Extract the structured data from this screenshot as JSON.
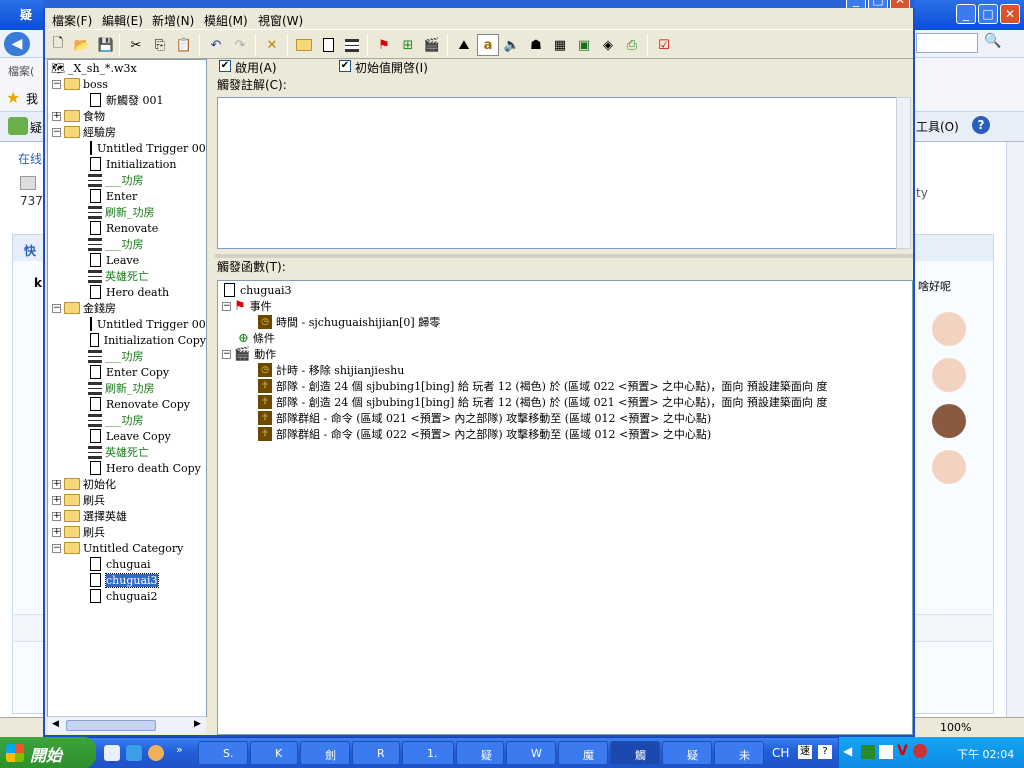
{
  "background_window": {
    "title": "疑",
    "menu": "檔案(",
    "fav_label": "我",
    "tab_label": "疑",
    "left_text1": "在线",
    "left_text2": "737",
    "left_text3": "快",
    "left_text4": "k",
    "right_text_ty": "ty",
    "tab_hint": "啥好呢",
    "tools_menu": "工具(O)",
    "zoom": "100%"
  },
  "menubar": {
    "items": [
      "檔案(F)",
      "編輯(E)",
      "新增(N)",
      "模組(M)",
      "視窗(W)"
    ]
  },
  "toolbar": {
    "icons": [
      "new-icon",
      "open-icon",
      "save-icon",
      "cut-icon",
      "copy-icon",
      "paste-icon",
      "undo-icon",
      "redo-icon",
      "delete-icon",
      "new-category-icon",
      "new-trigger-icon",
      "new-comment-icon",
      "event-flag-icon",
      "new-variable-icon",
      "test-map-icon",
      "terrain-editor-icon",
      "unit-editor-icon",
      "sound-editor-icon",
      "object-editor-icon",
      "import-manager-icon",
      "ai-editor-icon",
      "campaign-editor-icon",
      "object-manager-icon",
      "test-map-run-icon"
    ]
  },
  "tree": {
    "root": "_X_sh_*.w3x",
    "nodes": [
      {
        "level": 1,
        "type": "folder",
        "label": "boss",
        "expand": "-"
      },
      {
        "level": 2,
        "type": "doc",
        "label": "新觸發 001"
      },
      {
        "level": 1,
        "type": "folder",
        "label": "食物",
        "expand": "+"
      },
      {
        "level": 1,
        "type": "folder",
        "label": "經驗房",
        "expand": "-"
      },
      {
        "level": 2,
        "type": "doc",
        "label": "Untitled Trigger 001"
      },
      {
        "level": 2,
        "type": "doc",
        "label": "Initialization"
      },
      {
        "level": 2,
        "type": "var",
        "label": "___功房",
        "green": true
      },
      {
        "level": 2,
        "type": "doc",
        "label": "Enter"
      },
      {
        "level": 2,
        "type": "var",
        "label": "刷新_功房",
        "green": true
      },
      {
        "level": 2,
        "type": "doc",
        "label": "Renovate"
      },
      {
        "level": 2,
        "type": "var",
        "label": "___功房",
        "green": true
      },
      {
        "level": 2,
        "type": "doc",
        "label": "Leave"
      },
      {
        "level": 2,
        "type": "var",
        "label": "英雄死亡",
        "green": true
      },
      {
        "level": 2,
        "type": "doc",
        "label": "Hero death"
      },
      {
        "level": 1,
        "type": "folder",
        "label": "金錢房",
        "expand": "-"
      },
      {
        "level": 2,
        "type": "doc",
        "label": "Untitled Trigger 001"
      },
      {
        "level": 2,
        "type": "doc",
        "label": "Initialization Copy"
      },
      {
        "level": 2,
        "type": "var",
        "label": "___功房",
        "green": true
      },
      {
        "level": 2,
        "type": "doc",
        "label": "Enter Copy"
      },
      {
        "level": 2,
        "type": "var",
        "label": "刷新_功房",
        "green": true
      },
      {
        "level": 2,
        "type": "doc",
        "label": "Renovate Copy"
      },
      {
        "level": 2,
        "type": "var",
        "label": "___功房",
        "green": true
      },
      {
        "level": 2,
        "type": "doc",
        "label": "Leave Copy"
      },
      {
        "level": 2,
        "type": "var",
        "label": "英雄死亡",
        "green": true
      },
      {
        "level": 2,
        "type": "doc",
        "label": "Hero death Copy"
      },
      {
        "level": 1,
        "type": "folder",
        "label": "初始化",
        "expand": "+"
      },
      {
        "level": 1,
        "type": "folder",
        "label": "刷兵",
        "expand": "+"
      },
      {
        "level": 1,
        "type": "folder",
        "label": "選擇英雄",
        "expand": "+"
      },
      {
        "level": 1,
        "type": "folder",
        "label": "刷兵",
        "expand": "+"
      },
      {
        "level": 1,
        "type": "folder",
        "label": "Untitled Category",
        "expand": "-"
      },
      {
        "level": 2,
        "type": "doc",
        "label": "chuguai"
      },
      {
        "level": 2,
        "type": "doc",
        "label": "chuguai3",
        "selected": true
      },
      {
        "level": 2,
        "type": "doc",
        "label": "chuguai2"
      }
    ]
  },
  "trigger": {
    "enabled_label": "啟用(A)",
    "initially_on_label": "初始值開啓(I)",
    "comment_label": "觸發註解(C):",
    "functions_label": "觸發函數(T):",
    "name": "chuguai3",
    "events_label": "事件",
    "event_item": "時間 - sjchuguaishijian[0] 歸零",
    "conditions_label": "條件",
    "actions_label": "動作",
    "actions": [
      "計時 - 移除 shijianjieshu",
      "部隊 - 創造 24 個 sjbubing1[bing] 給 玩者 12 (褐色) 於 (區域 022 <預置> 之中心點)，面向 預設建築面向 度",
      "部隊 - 創造 24 個 sjbubing1[bing] 給 玩者 12 (褐色) 於 (區域 021 <預置> 之中心點)，面向 預設建築面向 度",
      "部隊群組 - 命令 (區域 021 <預置> 內之部隊) 攻擊移動至 (區域 012 <預置> 之中心點)",
      "部隊群組 - 命令 (區域 022 <預置> 內之部隊) 攻擊移動至 (區域 012 <預置> 之中心點)"
    ]
  },
  "taskbar": {
    "start": "開始",
    "items": [
      "S.",
      "K",
      "劍",
      "R",
      "1.",
      "疑",
      "W",
      "魔",
      "觸",
      "疑",
      "未"
    ],
    "ime": "CH",
    "clock": "下午 02:04"
  }
}
